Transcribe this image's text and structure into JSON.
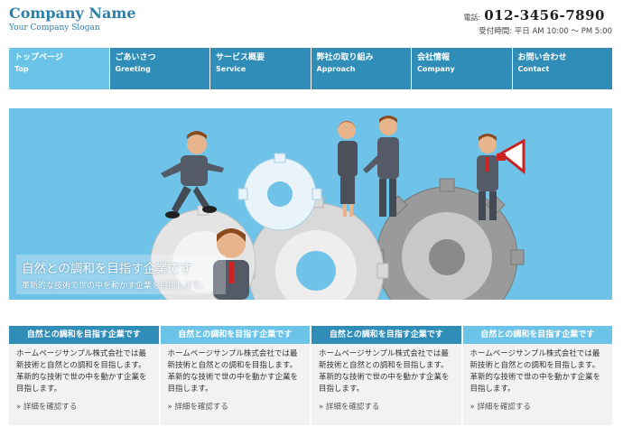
{
  "header": {
    "company_name": "Company Name",
    "slogan": "Your Company Slogan",
    "phone_label": "電話:",
    "phone_number": "012-3456-7890",
    "hours": "受付時間: 平日 AM 10:00 ～ PM 5:00"
  },
  "nav": {
    "items": [
      {
        "jp": "トップページ",
        "en": "Top"
      },
      {
        "jp": "ごあいさつ",
        "en": "Greeting"
      },
      {
        "jp": "サービス概要",
        "en": "Service"
      },
      {
        "jp": "弊社の取り組み",
        "en": "Approach"
      },
      {
        "jp": "会社情報",
        "en": "Company"
      },
      {
        "jp": "お問い合わせ",
        "en": "Contact"
      }
    ]
  },
  "hero": {
    "title": "自然との調和を目指す企業です",
    "subtitle": "革新的な技術で世の中を動かす企業を目指します。"
  },
  "features": [
    {
      "title": "自然との調和を目指す企業です",
      "text": "ホームページサンプル株式会社では最新技術と自然との調和を目指します。革新的な技術で世の中を動かす企業を目指します。",
      "link": "» 詳細を確認する"
    },
    {
      "title": "自然との調和を目指す企業です",
      "text": "ホームページサンプル株式会社では最新技術と自然との調和を目指します。革新的な技術で世の中を動かす企業を目指します。",
      "link": "» 詳細を確認する"
    },
    {
      "title": "自然との調和を目指す企業です",
      "text": "ホームページサンプル株式会社では最新技術と自然との調和を目指します。革新的な技術で世の中を動かす企業を目指します。",
      "link": "» 詳細を確認する"
    },
    {
      "title": "自然との調和を目指す企業です",
      "text": "ホームページサンプル株式会社では最新技術と自然との調和を目指します。革新的な技術で世の中を動かす企業を目指します。",
      "link": "» 詳細を確認する"
    }
  ],
  "colors": {
    "accent": "#2f8db8",
    "accent_light": "#6cc3e8",
    "hero_bg": "#6fc2e8"
  }
}
